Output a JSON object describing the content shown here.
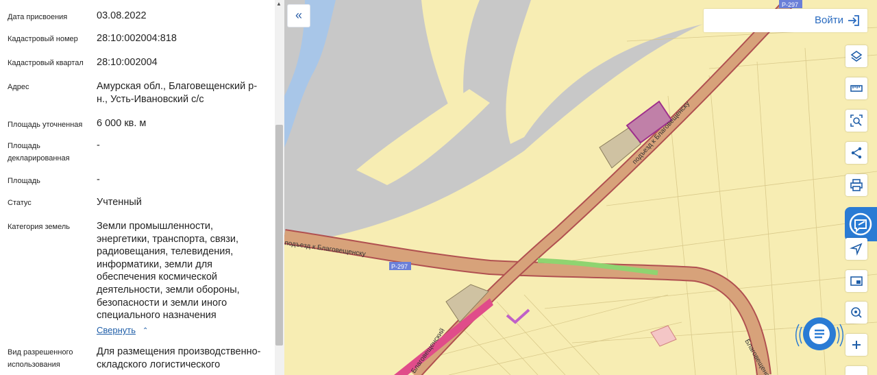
{
  "info": {
    "rows": [
      {
        "label": "Дата присвоения",
        "value": "03.08.2022"
      },
      {
        "label": "Кадастровый номер",
        "value": "28:10:002004:818"
      },
      {
        "label": "Кадастровый квартал",
        "value": "28:10:002004"
      },
      {
        "label": "Адрес",
        "value": "Амурская обл., Благовещенский р-н., Усть-Ивановский с/с"
      },
      {
        "label": "Площадь уточненная",
        "value": "6 000 кв. м"
      },
      {
        "label": "Площадь декларированная",
        "value": "-"
      },
      {
        "label": "Площадь",
        "value": "-"
      },
      {
        "label": "Статус",
        "value": "Учтенный"
      },
      {
        "label": "Категория земель",
        "value": "Земли промышленности, энергетики, транспорта, связи, радиовещания, телевидения, информатики, земли для обеспечения космической деятельности, земли обороны, безопасности и земли иного специального назначения"
      },
      {
        "label": "Вид разрешенного использования",
        "value": "Для размещения производственно-складского логистического"
      }
    ],
    "collapse_label": "Свернуть"
  },
  "map": {
    "login_label": "Войти",
    "road_labels": {
      "main_left": "подъезд к Благовещенску",
      "diagonal": "подъезд к Благовещенску",
      "route_code_left": "Р-297",
      "route_code_top": "Р-297",
      "bottom_left": "Благовещенский",
      "bottom_right": "Благовещенск"
    },
    "colors": {
      "river": "#a8c6e8",
      "water_grey": "#c8c8c8",
      "land": "#f7edb3",
      "road": "#d7a27a",
      "road_border": "#b05050",
      "selected_parcel": "#c080a8",
      "building": "#cfc2a2",
      "accent": "#2a7bd4"
    },
    "tools": [
      "layers-icon",
      "ruler-icon",
      "search-area-icon",
      "share-icon",
      "print-icon",
      "location-icon",
      "minimap-icon",
      "geo-search-icon",
      "zoom-in-icon"
    ]
  }
}
